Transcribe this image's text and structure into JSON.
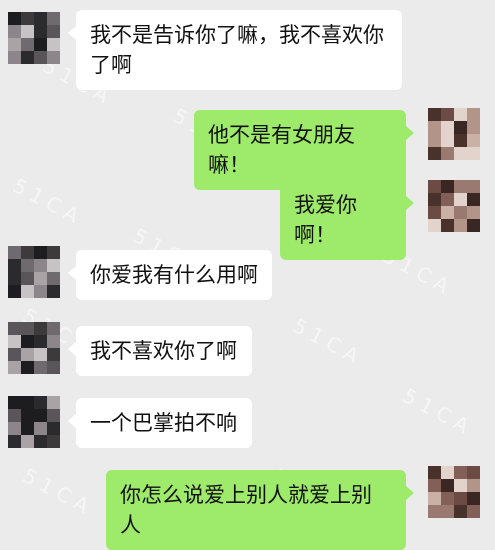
{
  "messages": [
    {
      "side": "in",
      "text": "我不是告诉你了嘛，我不喜欢你了啊"
    },
    {
      "side": "out",
      "text": "他不是有女朋友嘛！"
    },
    {
      "side": "out",
      "text": "我爱你啊！"
    },
    {
      "side": "in",
      "text": "你爱我有什么用啊"
    },
    {
      "side": "in",
      "text": "我不喜欢你了啊"
    },
    {
      "side": "in",
      "text": "一个巴掌拍不响"
    },
    {
      "side": "out",
      "text": "你怎么说爱上别人就爱上别人"
    }
  ],
  "watermark": "51CA",
  "colors": {
    "background": "#ebebeb",
    "bubble_in": "#ffffff",
    "bubble_out": "#9eea6a"
  }
}
